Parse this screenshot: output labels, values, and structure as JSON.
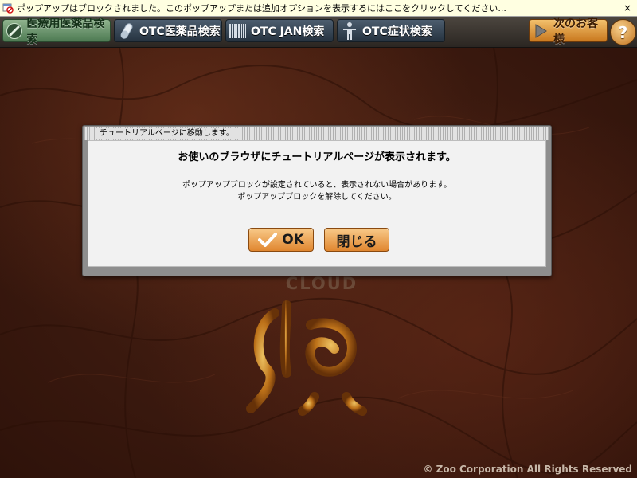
{
  "infobar": {
    "text": "ポップアップはブロックされました。このポップアップまたは追加オプションを表示するにはここをクリックしてください...",
    "close_label": "×"
  },
  "toolbar": {
    "buttons": [
      {
        "label": "医療用医薬品検索",
        "icon": "pill-slash-icon",
        "style": "active"
      },
      {
        "label": "OTC医薬品検索",
        "icon": "capsule-icon",
        "style": "dark"
      },
      {
        "label": "OTC JAN検索",
        "icon": "barcode-icon",
        "style": "dark"
      },
      {
        "label": "OTC症状検索",
        "icon": "person-icon",
        "style": "dark"
      },
      {
        "label": "次のお客様",
        "icon": "play-arrow-icon",
        "style": "orange"
      }
    ],
    "help_label": "?"
  },
  "dialog": {
    "title": "チュートリアルページに移動します。",
    "heading": "お使いのブラウザにチュートリアルページが表示されます。",
    "message_line1": "ポップアップブロックが設定されていると、表示されない場合があります。",
    "message_line2": "ポップアップブロックを解除してください。",
    "ok_label": "OK",
    "close_label": "閉じる"
  },
  "logo": {
    "text": "CLOUD"
  },
  "footer": {
    "copyright": "© Zoo Corporation All Rights Reserved"
  },
  "colors": {
    "background": "#3a1a10",
    "infobar": "#ffffe1",
    "toolbar": "#2b2622",
    "active_button": "#6e9a70",
    "orange_button": "#e0862f",
    "dialog_frame": "#8e8e8e",
    "dialog_body": "#f2f2f2",
    "logo_gold": "#e0a030"
  }
}
